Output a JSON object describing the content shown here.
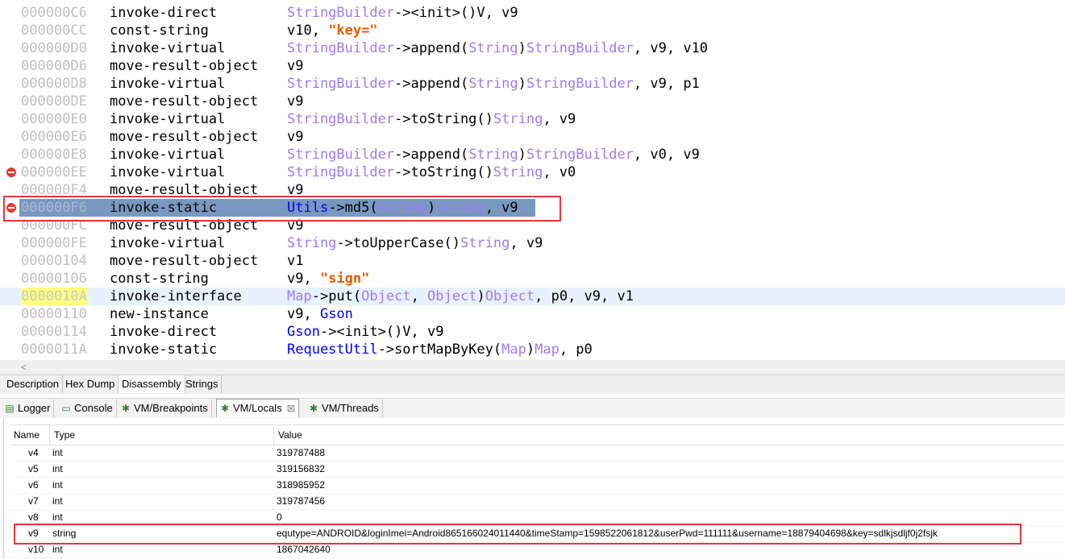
{
  "code": {
    "lines": [
      {
        "addr": "000000C6",
        "op": "invoke-direct",
        "args": [
          [
            "t",
            "StringBuilder"
          ],
          [
            "p",
            "-><init>()V, v9"
          ]
        ]
      },
      {
        "addr": "000000CC",
        "op": "const-string",
        "args": [
          [
            "p",
            "v10, "
          ],
          [
            "s",
            "\"key=\""
          ]
        ]
      },
      {
        "addr": "000000D0",
        "op": "invoke-virtual",
        "args": [
          [
            "t",
            "StringBuilder"
          ],
          [
            "p",
            "->append("
          ],
          [
            "t",
            "String"
          ],
          [
            "p",
            ")"
          ],
          [
            "t",
            "StringBuilder"
          ],
          [
            "p",
            ", v9, v10"
          ]
        ]
      },
      {
        "addr": "000000D6",
        "op": "move-result-object",
        "args": [
          [
            "p",
            "v9"
          ]
        ]
      },
      {
        "addr": "000000D8",
        "op": "invoke-virtual",
        "args": [
          [
            "t",
            "StringBuilder"
          ],
          [
            "p",
            "->append("
          ],
          [
            "t",
            "String"
          ],
          [
            "p",
            ")"
          ],
          [
            "t",
            "StringBuilder"
          ],
          [
            "p",
            ", v9, p1"
          ]
        ]
      },
      {
        "addr": "000000DE",
        "op": "move-result-object",
        "args": [
          [
            "p",
            "v9"
          ]
        ]
      },
      {
        "addr": "000000E0",
        "op": "invoke-virtual",
        "args": [
          [
            "t",
            "StringBuilder"
          ],
          [
            "p",
            "->toString()"
          ],
          [
            "t",
            "String"
          ],
          [
            "p",
            ", v9"
          ]
        ]
      },
      {
        "addr": "000000E6",
        "op": "move-result-object",
        "args": [
          [
            "p",
            "v9"
          ]
        ]
      },
      {
        "addr": "000000E8",
        "op": "invoke-virtual",
        "args": [
          [
            "t",
            "StringBuilder"
          ],
          [
            "p",
            "->append("
          ],
          [
            "t",
            "String"
          ],
          [
            "p",
            ")"
          ],
          [
            "t",
            "StringBuilder"
          ],
          [
            "p",
            ", v0, v9"
          ]
        ]
      },
      {
        "addr": "000000EE",
        "op": "invoke-virtual",
        "args": [
          [
            "t",
            "StringBuilder"
          ],
          [
            "p",
            "->toString()"
          ],
          [
            "t",
            "String"
          ],
          [
            "p",
            ", v0"
          ]
        ],
        "breakpoint": true
      },
      {
        "addr": "000000F4",
        "op": "move-result-object",
        "args": [
          [
            "p",
            "v9"
          ]
        ]
      },
      {
        "addr": "000000F6",
        "op": "invoke-static",
        "args": [
          [
            "k",
            "Utils"
          ],
          [
            "p",
            "->md5("
          ],
          [
            "t",
            "String"
          ],
          [
            "p",
            ")"
          ],
          [
            "t",
            "String"
          ],
          [
            "p",
            ", v9"
          ]
        ],
        "breakpoint": true,
        "selected": true
      },
      {
        "addr": "000000FC",
        "op": "move-result-object",
        "args": [
          [
            "p",
            "v9"
          ]
        ]
      },
      {
        "addr": "000000FE",
        "op": "invoke-virtual",
        "args": [
          [
            "t",
            "String"
          ],
          [
            "p",
            "->toUpperCase()"
          ],
          [
            "t",
            "String"
          ],
          [
            "p",
            ", v9"
          ]
        ]
      },
      {
        "addr": "00000104",
        "op": "move-result-object",
        "args": [
          [
            "p",
            "v1"
          ]
        ]
      },
      {
        "addr": "00000106",
        "op": "const-string",
        "args": [
          [
            "p",
            "v9, "
          ],
          [
            "s",
            "\"sign\""
          ]
        ]
      },
      {
        "addr": "0000010A",
        "op": "invoke-interface",
        "args": [
          [
            "t",
            "Map"
          ],
          [
            "p",
            "->put("
          ],
          [
            "t",
            "Object"
          ],
          [
            "p",
            ", "
          ],
          [
            "t",
            "Object"
          ],
          [
            "p",
            ")"
          ],
          [
            "t",
            "Object"
          ],
          [
            "p",
            ", p0, v9, v1"
          ]
        ],
        "current": true
      },
      {
        "addr": "00000110",
        "op": "new-instance",
        "args": [
          [
            "p",
            "v9, "
          ],
          [
            "k",
            "Gson"
          ]
        ]
      },
      {
        "addr": "00000114",
        "op": "invoke-direct",
        "args": [
          [
            "k",
            "Gson"
          ],
          [
            "p",
            "-><init>()V, v9"
          ]
        ]
      },
      {
        "addr": "0000011A",
        "op": "invoke-static",
        "args": [
          [
            "k",
            "RequestUtil"
          ],
          [
            "p",
            "->sortMapByKey("
          ],
          [
            "t",
            "Map"
          ],
          [
            "p",
            ")"
          ],
          [
            "t",
            "Map"
          ],
          [
            "p",
            ", p0"
          ]
        ]
      }
    ]
  },
  "scroll": {
    "left_arrow": "<"
  },
  "editor_tabs": [
    "Description",
    "Hex Dump",
    "Disassembly",
    "Strings"
  ],
  "editor_active_tab": "Disassembly",
  "view_tabs": [
    {
      "label": "Logger",
      "icon": "logger-icon",
      "glyph": "▤"
    },
    {
      "label": "Console",
      "icon": "console-icon",
      "glyph": "▭"
    },
    {
      "label": "VM/Breakpoints",
      "icon": "bug-icon",
      "glyph": "✱"
    },
    {
      "label": "VM/Locals",
      "icon": "bug-icon",
      "glyph": "✱",
      "active": true,
      "close": "☒"
    },
    {
      "label": "VM/Threads",
      "icon": "bug-icon",
      "glyph": "✱"
    }
  ],
  "locals": {
    "headers": {
      "name": "Name",
      "type": "Type",
      "value": "Value"
    },
    "rows": [
      {
        "name": "v4",
        "type": "int",
        "value": "319787488"
      },
      {
        "name": "v5",
        "type": "int",
        "value": "319156832"
      },
      {
        "name": "v6",
        "type": "int",
        "value": "318985952"
      },
      {
        "name": "v7",
        "type": "int",
        "value": "319787456"
      },
      {
        "name": "v8",
        "type": "int",
        "value": "0"
      },
      {
        "name": "v9",
        "type": "string",
        "value": "equtype=ANDROID&loginImei=Android865166024011440&timeStamp=1598522061812&userPwd=111111&username=18879404698&key=sdlkjsdljf0j2fsjk"
      },
      {
        "name": "v10",
        "type": "int",
        "value": "1867042640"
      }
    ]
  }
}
